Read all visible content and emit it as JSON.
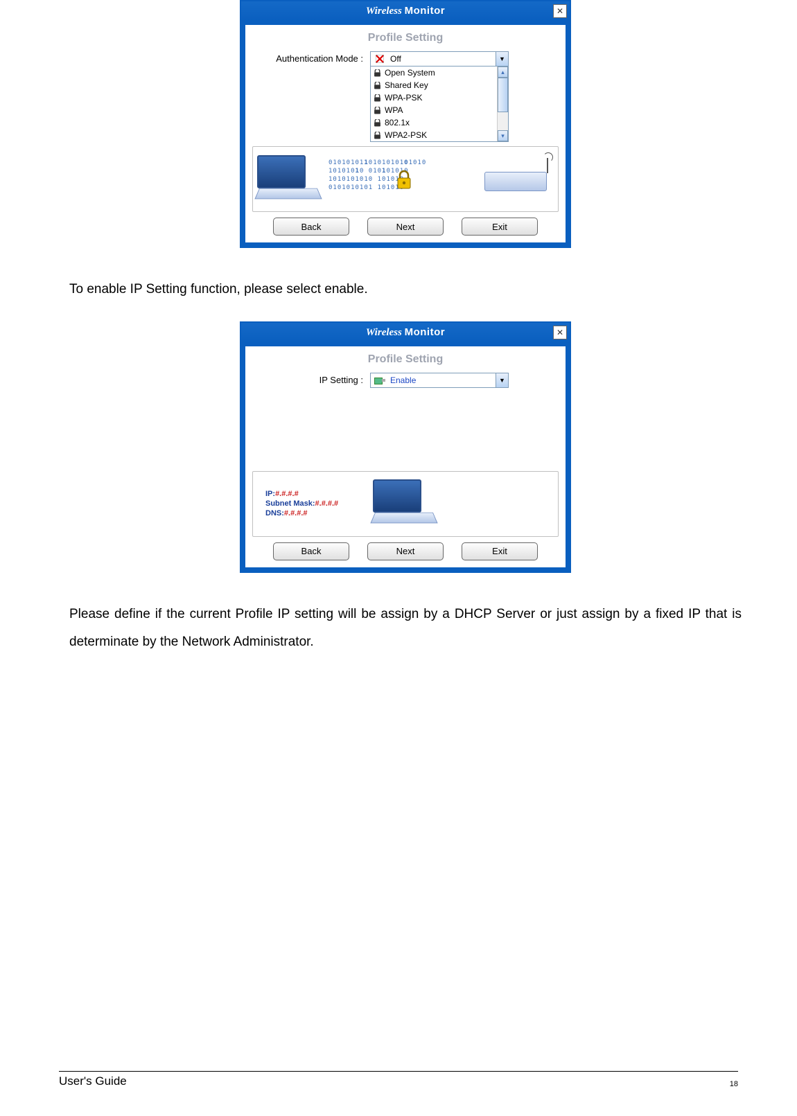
{
  "doc": {
    "paragraph1": "To enable IP Setting function, please select enable.",
    "paragraph2": "Please define if the current Profile IP setting will be assign by a DHCP Server or just assign by a fixed IP that is determinate by the Network Administrator.",
    "footer_left": "User's Guide",
    "page_number": "18"
  },
  "dialog1": {
    "app_title_italic": "Wireless",
    "app_title_bold": "Monitor",
    "section": "Profile Setting",
    "label": "Authentication Mode :",
    "selected": "Off",
    "options": [
      "Open System",
      "Shared Key",
      "WPA-PSK",
      "WPA",
      "802.1x",
      "WPA2-PSK"
    ],
    "buttons": {
      "back": "Back",
      "next": "Next",
      "exit": "Exit"
    }
  },
  "dialog2": {
    "app_title_italic": "Wireless",
    "app_title_bold": "Monitor",
    "section": "Profile Setting",
    "label": "IP Setting :",
    "selected": "Enable",
    "illu": {
      "ip_lbl": "IP:",
      "ip_val": "#.#.#.#",
      "mask_lbl": "Subnet Mask:",
      "mask_val": "#.#.#.#",
      "dns_lbl": "DNS:",
      "dns_val": "#.#.#.#"
    },
    "buttons": {
      "back": "Back",
      "next": "Next",
      "exit": "Exit"
    }
  }
}
